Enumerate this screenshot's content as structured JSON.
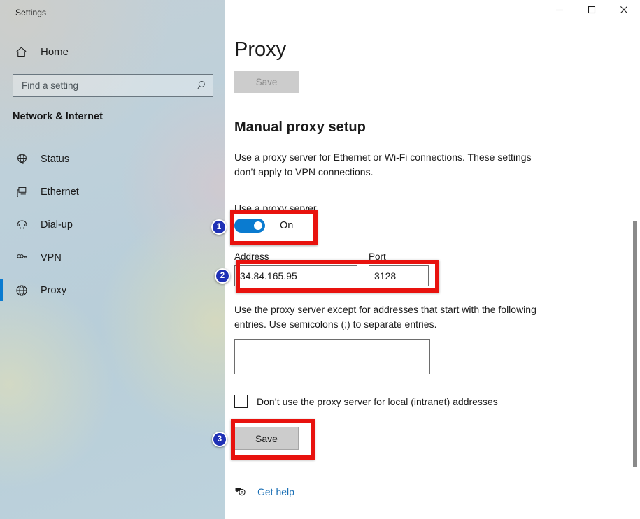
{
  "window": {
    "title": "Settings",
    "controls": {
      "minimize": "minimize-icon",
      "maximize": "maximize-icon",
      "close": "close-icon"
    }
  },
  "sidebar": {
    "home_label": "Home",
    "home_icon": "home-icon",
    "search": {
      "placeholder": "Find a setting",
      "value": "",
      "icon": "search-icon"
    },
    "category": "Network & Internet",
    "items": [
      {
        "label": "Status",
        "icon": "status-globe-icon",
        "active": false
      },
      {
        "label": "Ethernet",
        "icon": "ethernet-icon",
        "active": false
      },
      {
        "label": "Dial-up",
        "icon": "dialup-phone-icon",
        "active": false
      },
      {
        "label": "VPN",
        "icon": "vpn-key-icon",
        "active": false
      },
      {
        "label": "Proxy",
        "icon": "proxy-globe-icon",
        "active": true
      }
    ]
  },
  "main": {
    "page_title": "Proxy",
    "save_top_label": "Save",
    "section_title": "Manual proxy setup",
    "description": "Use a proxy server for Ethernet or Wi-Fi connections. These settings don’t apply to VPN connections.",
    "use_proxy_label": "Use a proxy server",
    "toggle_state": "On",
    "address_label": "Address",
    "address_value": "34.84.165.95",
    "port_label": "Port",
    "port_value": "3128",
    "exceptions_description": "Use the proxy server except for addresses that start with the following entries. Use semicolons (;) to separate entries.",
    "exceptions_value": "",
    "checkbox_label": "Don’t use the proxy server for local (intranet) addresses",
    "checkbox_checked": false,
    "save_bottom_label": "Save",
    "help_link": "Get help",
    "help_icon": "help-bubble-icon"
  },
  "annotations": {
    "markers": [
      {
        "number": "1",
        "target": "use-a-proxy-server-toggle"
      },
      {
        "number": "2",
        "target": "address-and-port-fields"
      },
      {
        "number": "3",
        "target": "save-button"
      }
    ],
    "box_color": "#e8120e",
    "marker_color": "#1f31b5"
  },
  "colors": {
    "accent": "#0a7bd0",
    "link": "#1a6fb5",
    "annotation_red": "#e8120e",
    "annotation_blue": "#1f31b5"
  }
}
